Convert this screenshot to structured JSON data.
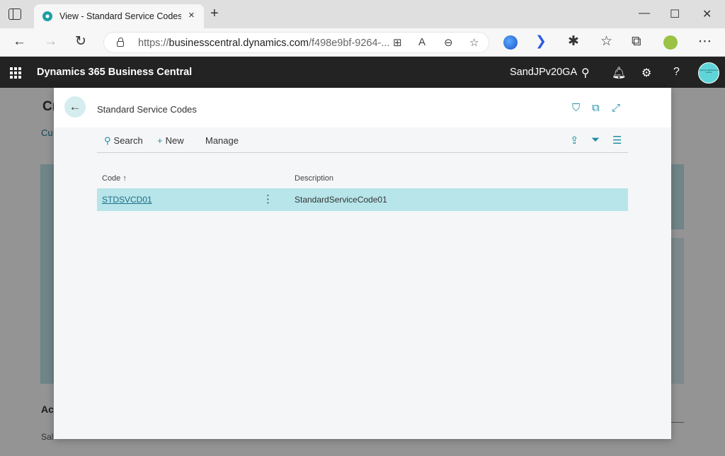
{
  "browser": {
    "tab_title": "View - Standard Service Codes - Dyna",
    "tab_close": "×",
    "new_tab": "+",
    "url_prefix": "https://",
    "url_host": "businesscentral.dynamics.com",
    "url_rest": "/f498e9bf-9264-...",
    "window_minimize": "—",
    "window_maximize": "☐",
    "window_close": "✕"
  },
  "bc": {
    "app_title": "Dynamics 365 Business Central",
    "company": "SandJPv20GA",
    "avatar_text": "Dynamics 365 Business Central"
  },
  "background_page": {
    "heading": "Cr",
    "link": "Cu",
    "activities": "Ac",
    "sales": "Sal"
  },
  "dialog": {
    "title": "Standard Service Codes",
    "actions": {
      "search": "Search",
      "new": "New",
      "manage": "Manage"
    },
    "table": {
      "columns": [
        "Code",
        "Description"
      ],
      "sort_indicator": "↑",
      "rows": [
        {
          "code": "STDSVCD01",
          "description": "StandardServiceCode01"
        }
      ]
    }
  }
}
